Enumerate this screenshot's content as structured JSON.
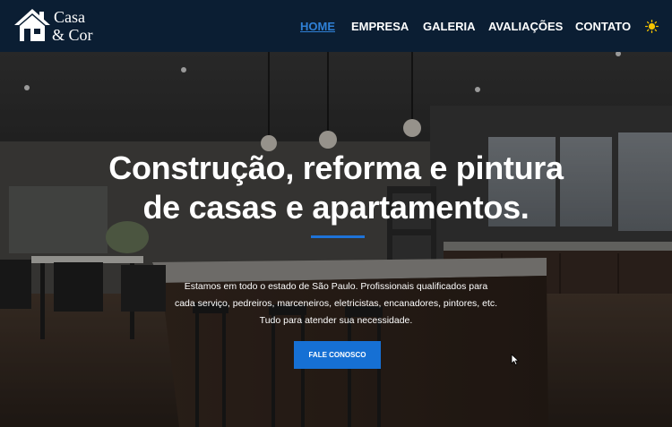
{
  "brand": {
    "line1": "Casa",
    "line2": "& Cor",
    "logo_icon": "house-icon"
  },
  "nav": {
    "items": [
      {
        "label": "HOME",
        "active": true
      },
      {
        "label": "EMPRESA",
        "active": false
      },
      {
        "label": "GALERIA",
        "active": false
      },
      {
        "label": "AVALIAÇÕES",
        "active": false
      },
      {
        "label": "CONTATO",
        "active": false
      }
    ],
    "theme_icon": "sun-icon"
  },
  "hero": {
    "title_line1": "Construção, reforma e pintura",
    "title_line2": "de casas e apartamentos.",
    "desc_line1": "Estamos em todo o estado de São Paulo. Profissionais qualificados para",
    "desc_line2": "cada serviço, pedreiros, marceneiros, eletricistas, encanadores, pintores, etc.",
    "desc_line3": "Tudo para atender sua necessidade.",
    "cta_label": "FALE CONOSCO",
    "background": "kitchen-photo"
  },
  "colors": {
    "header_bg": "#0b1e33",
    "accent": "#1670d4",
    "nav_active": "#2f80d6",
    "sun": "#f5c400"
  }
}
